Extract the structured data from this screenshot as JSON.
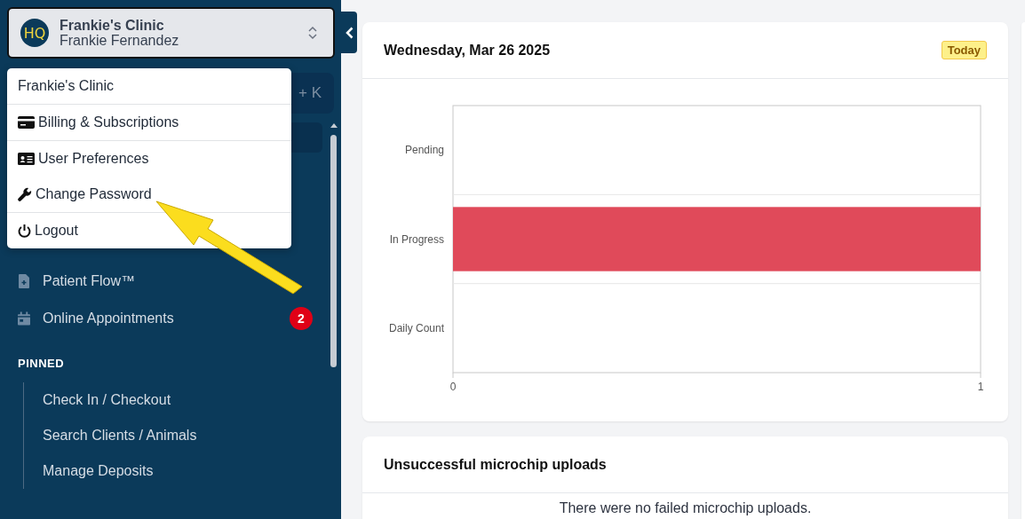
{
  "account_switcher": {
    "clinic": "Frankie's Clinic",
    "user": "Frankie Fernandez",
    "logo": "HQ"
  },
  "account_menu": {
    "header": "Frankie's Clinic",
    "items": [
      {
        "label": "Billing & Subscriptions",
        "kind": "card",
        "divider_before": true
      },
      {
        "label": "User Preferences",
        "kind": "id",
        "divider_before": true
      },
      {
        "label": "Change Password",
        "kind": "wrench",
        "divider_before": false
      },
      {
        "label": "Logout",
        "kind": "power",
        "divider_before": true
      }
    ]
  },
  "search_shortcut": "+ K",
  "nav_items": [
    {
      "label": "Patient Flow™",
      "kind": "file"
    },
    {
      "label": "Online Appointments",
      "kind": "calendar",
      "badge": "2"
    }
  ],
  "pinned": {
    "heading": "PINNED",
    "items": [
      "Check In / Checkout",
      "Search Clients / Animals",
      "Manage Deposits"
    ]
  },
  "status_card": {
    "title": "Wednesday, Mar 26 2025",
    "badge": "Today",
    "chart_data": {
      "type": "bar",
      "orientation": "horizontal",
      "categories": [
        "Pending",
        "In Progress",
        "Daily Count"
      ],
      "series": [
        {
          "color": "#e04a5a",
          "values": [
            0,
            1,
            0
          ]
        }
      ],
      "xlim": [
        0,
        1
      ],
      "xticks": [
        0,
        1
      ]
    }
  },
  "microchip_card": {
    "title": "Unsuccessful microchip uploads",
    "message": "There were no failed microchip uploads."
  }
}
